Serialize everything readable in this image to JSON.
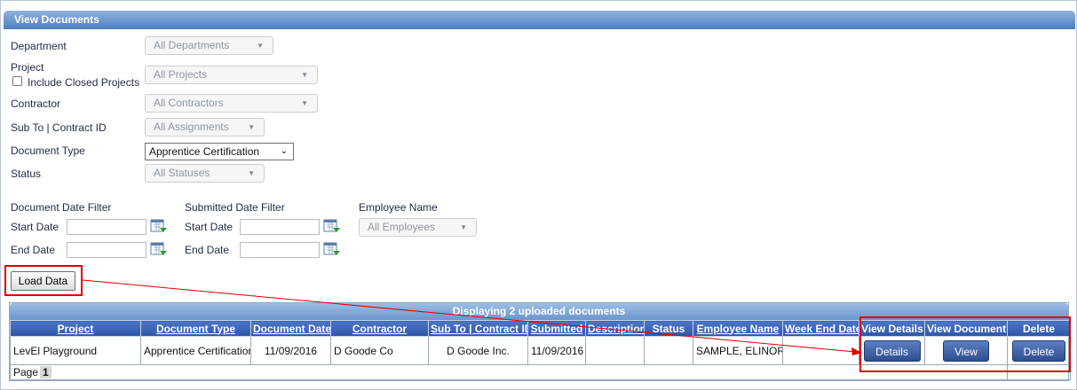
{
  "panel_title": "View Documents",
  "filters": {
    "department": {
      "label": "Department",
      "value": "All Departments"
    },
    "project": {
      "label": "Project",
      "value": "All Projects",
      "include_closed_label": "Include Closed Projects"
    },
    "contractor": {
      "label": "Contractor",
      "value": "All Contractors"
    },
    "sub_to": {
      "label": "Sub To | Contract ID",
      "value": "All Assignments"
    },
    "document_type": {
      "label": "Document Type",
      "value": "Apprentice Certification"
    },
    "status": {
      "label": "Status",
      "value": "All Statuses"
    }
  },
  "date_filters": {
    "document": {
      "title": "Document Date Filter",
      "start_label": "Start Date",
      "end_label": "End Date",
      "start_value": "",
      "end_value": ""
    },
    "submitted": {
      "title": "Submitted Date Filter",
      "start_label": "Start Date",
      "end_label": "End Date",
      "start_value": "",
      "end_value": ""
    },
    "employee": {
      "title": "Employee Name",
      "value": "All Employees"
    }
  },
  "load_button": "Load Data",
  "grid": {
    "caption": "Displaying 2 uploaded documents",
    "columns": [
      "Project",
      "Document Type",
      "Document Date",
      "Contractor",
      "Sub To | Contract ID",
      "Submitted",
      "Description",
      "Status",
      "Employee Name",
      "Week End Date",
      "View Details",
      "View Document",
      "Delete"
    ],
    "row": {
      "project": "LevEl Playground",
      "document_type": "Apprentice Certification",
      "document_date": "11/09/2016",
      "contractor": "D Goode Co",
      "sub_to": "D Goode Inc.",
      "submitted": "11/09/2016",
      "description": "",
      "status": "",
      "employee_name": "SAMPLE, ELINOR",
      "week_end_date": "",
      "details_btn": "Details",
      "view_btn": "View",
      "delete_btn": "Delete"
    },
    "pager_label": "Page",
    "pager_current": "1"
  },
  "colors": {
    "highlight": "#e00000",
    "header_blue": "#2f56a6",
    "title_blue": "#4f7fc0"
  }
}
